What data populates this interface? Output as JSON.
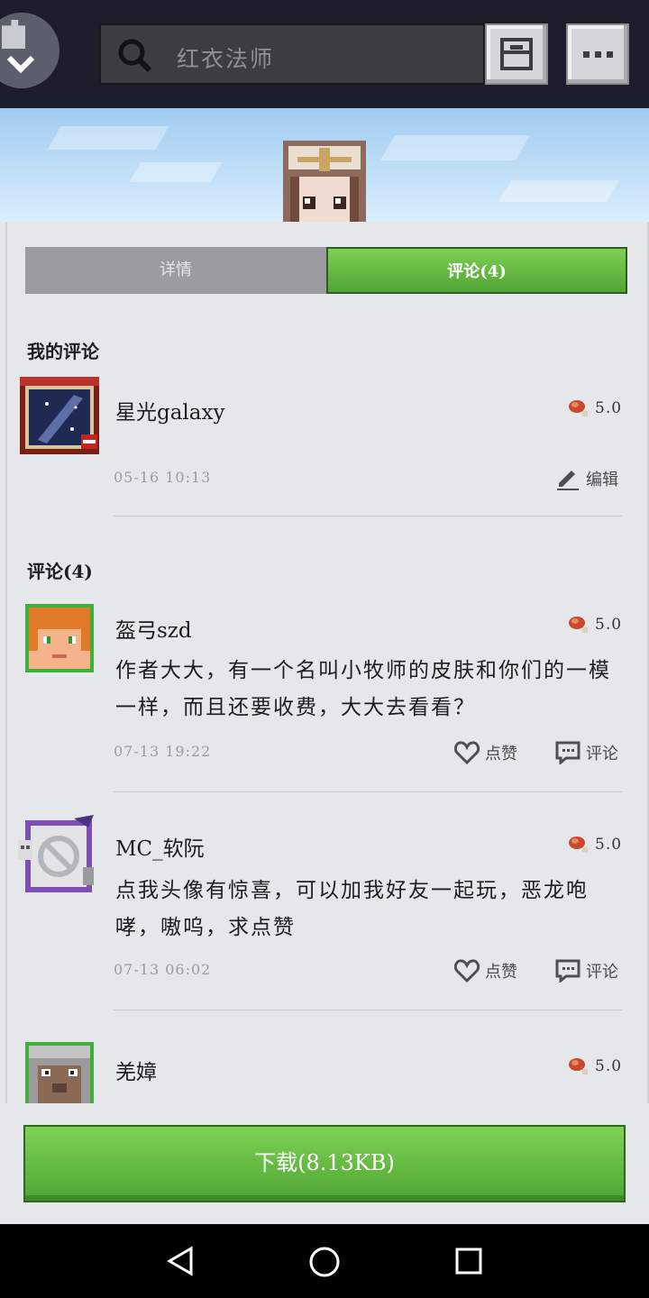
{
  "search": {
    "placeholder": "红衣法师"
  },
  "tabs": [
    {
      "label": "详情",
      "active": false
    },
    {
      "label": "评论(4)",
      "active": true
    }
  ],
  "my_review": {
    "heading": "我的评论",
    "username": "星光galaxy",
    "rating": "5.0",
    "time": "05-16  10:13",
    "edit_label": "编辑"
  },
  "reviews_heading": "评论(4)",
  "comments": [
    {
      "username": "盔弓szd",
      "rating": "5.0",
      "text": "作者大大，有一个名叫小牧师的皮肤和你们的一模一样，而且还要收费，大大去看看？",
      "time": "07-13  19:22",
      "like_label": "点赞",
      "comment_label": "评论"
    },
    {
      "username": "MC_软阮",
      "rating": "5.0",
      "text": "点我头像有惊喜，可以加我好友一起玩，恶龙咆哮，嗷呜，求点赞",
      "time": "07-13  06:02",
      "like_label": "点赞",
      "comment_label": "评论"
    },
    {
      "username": "羌嫜",
      "rating": "5.0",
      "text": "",
      "time": "",
      "like_label": "",
      "comment_label": ""
    }
  ],
  "download": {
    "label": "下载(8.13KB)"
  },
  "colors": {
    "accent_green": "#5cb83c",
    "topbar": "#1b1e2a"
  }
}
